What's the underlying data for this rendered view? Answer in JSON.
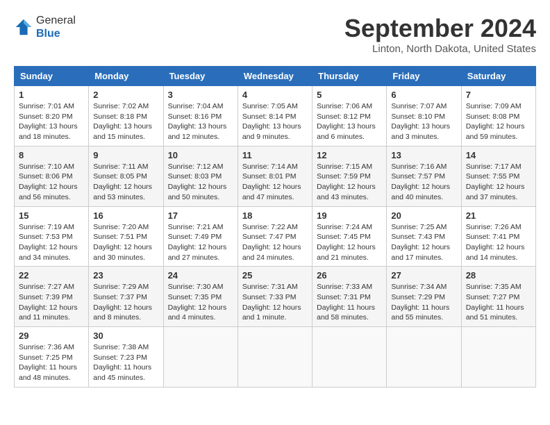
{
  "header": {
    "logo_general": "General",
    "logo_blue": "Blue",
    "title": "September 2024",
    "location": "Linton, North Dakota, United States"
  },
  "weekdays": [
    "Sunday",
    "Monday",
    "Tuesday",
    "Wednesday",
    "Thursday",
    "Friday",
    "Saturday"
  ],
  "weeks": [
    [
      {
        "day": "1",
        "info": "Sunrise: 7:01 AM\nSunset: 8:20 PM\nDaylight: 13 hours and 18 minutes."
      },
      {
        "day": "2",
        "info": "Sunrise: 7:02 AM\nSunset: 8:18 PM\nDaylight: 13 hours and 15 minutes."
      },
      {
        "day": "3",
        "info": "Sunrise: 7:04 AM\nSunset: 8:16 PM\nDaylight: 13 hours and 12 minutes."
      },
      {
        "day": "4",
        "info": "Sunrise: 7:05 AM\nSunset: 8:14 PM\nDaylight: 13 hours and 9 minutes."
      },
      {
        "day": "5",
        "info": "Sunrise: 7:06 AM\nSunset: 8:12 PM\nDaylight: 13 hours and 6 minutes."
      },
      {
        "day": "6",
        "info": "Sunrise: 7:07 AM\nSunset: 8:10 PM\nDaylight: 13 hours and 3 minutes."
      },
      {
        "day": "7",
        "info": "Sunrise: 7:09 AM\nSunset: 8:08 PM\nDaylight: 12 hours and 59 minutes."
      }
    ],
    [
      {
        "day": "8",
        "info": "Sunrise: 7:10 AM\nSunset: 8:06 PM\nDaylight: 12 hours and 56 minutes."
      },
      {
        "day": "9",
        "info": "Sunrise: 7:11 AM\nSunset: 8:05 PM\nDaylight: 12 hours and 53 minutes."
      },
      {
        "day": "10",
        "info": "Sunrise: 7:12 AM\nSunset: 8:03 PM\nDaylight: 12 hours and 50 minutes."
      },
      {
        "day": "11",
        "info": "Sunrise: 7:14 AM\nSunset: 8:01 PM\nDaylight: 12 hours and 47 minutes."
      },
      {
        "day": "12",
        "info": "Sunrise: 7:15 AM\nSunset: 7:59 PM\nDaylight: 12 hours and 43 minutes."
      },
      {
        "day": "13",
        "info": "Sunrise: 7:16 AM\nSunset: 7:57 PM\nDaylight: 12 hours and 40 minutes."
      },
      {
        "day": "14",
        "info": "Sunrise: 7:17 AM\nSunset: 7:55 PM\nDaylight: 12 hours and 37 minutes."
      }
    ],
    [
      {
        "day": "15",
        "info": "Sunrise: 7:19 AM\nSunset: 7:53 PM\nDaylight: 12 hours and 34 minutes."
      },
      {
        "day": "16",
        "info": "Sunrise: 7:20 AM\nSunset: 7:51 PM\nDaylight: 12 hours and 30 minutes."
      },
      {
        "day": "17",
        "info": "Sunrise: 7:21 AM\nSunset: 7:49 PM\nDaylight: 12 hours and 27 minutes."
      },
      {
        "day": "18",
        "info": "Sunrise: 7:22 AM\nSunset: 7:47 PM\nDaylight: 12 hours and 24 minutes."
      },
      {
        "day": "19",
        "info": "Sunrise: 7:24 AM\nSunset: 7:45 PM\nDaylight: 12 hours and 21 minutes."
      },
      {
        "day": "20",
        "info": "Sunrise: 7:25 AM\nSunset: 7:43 PM\nDaylight: 12 hours and 17 minutes."
      },
      {
        "day": "21",
        "info": "Sunrise: 7:26 AM\nSunset: 7:41 PM\nDaylight: 12 hours and 14 minutes."
      }
    ],
    [
      {
        "day": "22",
        "info": "Sunrise: 7:27 AM\nSunset: 7:39 PM\nDaylight: 12 hours and 11 minutes."
      },
      {
        "day": "23",
        "info": "Sunrise: 7:29 AM\nSunset: 7:37 PM\nDaylight: 12 hours and 8 minutes."
      },
      {
        "day": "24",
        "info": "Sunrise: 7:30 AM\nSunset: 7:35 PM\nDaylight: 12 hours and 4 minutes."
      },
      {
        "day": "25",
        "info": "Sunrise: 7:31 AM\nSunset: 7:33 PM\nDaylight: 12 hours and 1 minute."
      },
      {
        "day": "26",
        "info": "Sunrise: 7:33 AM\nSunset: 7:31 PM\nDaylight: 11 hours and 58 minutes."
      },
      {
        "day": "27",
        "info": "Sunrise: 7:34 AM\nSunset: 7:29 PM\nDaylight: 11 hours and 55 minutes."
      },
      {
        "day": "28",
        "info": "Sunrise: 7:35 AM\nSunset: 7:27 PM\nDaylight: 11 hours and 51 minutes."
      }
    ],
    [
      {
        "day": "29",
        "info": "Sunrise: 7:36 AM\nSunset: 7:25 PM\nDaylight: 11 hours and 48 minutes."
      },
      {
        "day": "30",
        "info": "Sunrise: 7:38 AM\nSunset: 7:23 PM\nDaylight: 11 hours and 45 minutes."
      },
      {
        "day": "",
        "info": ""
      },
      {
        "day": "",
        "info": ""
      },
      {
        "day": "",
        "info": ""
      },
      {
        "day": "",
        "info": ""
      },
      {
        "day": "",
        "info": ""
      }
    ]
  ]
}
